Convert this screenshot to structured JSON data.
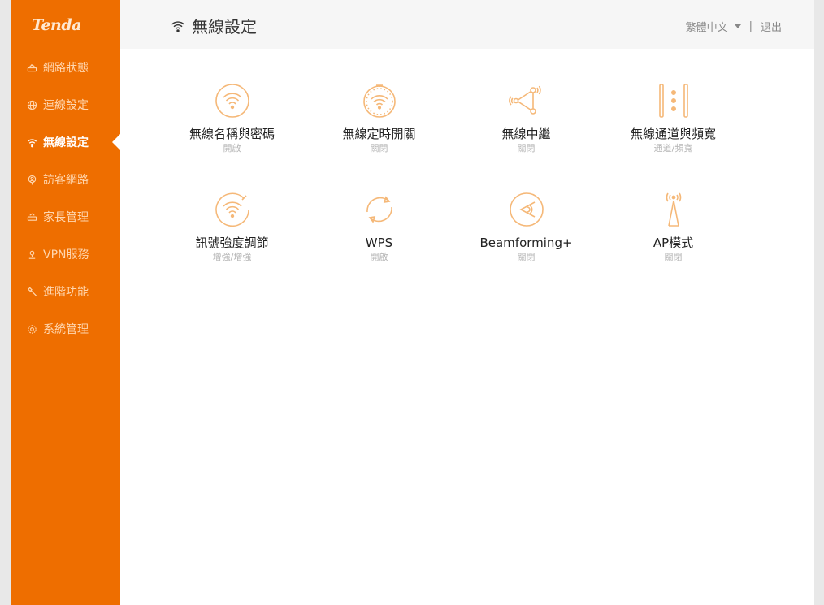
{
  "brand": {
    "logo_text": "Tenda",
    "accent_color": "#ee6e00",
    "icon_color": "#f5b878"
  },
  "sidebar": {
    "items": [
      {
        "label": "網路狀態",
        "icon": "router-icon",
        "active": false
      },
      {
        "label": "連線設定",
        "icon": "globe-icon",
        "active": false
      },
      {
        "label": "無線設定",
        "icon": "wifi-icon",
        "active": true
      },
      {
        "label": "訪客網路",
        "icon": "guest-icon",
        "active": false
      },
      {
        "label": "家長管理",
        "icon": "parental-icon",
        "active": false
      },
      {
        "label": "VPN服務",
        "icon": "vpn-icon",
        "active": false
      },
      {
        "label": "進階功能",
        "icon": "wrench-icon",
        "active": false
      },
      {
        "label": "系統管理",
        "icon": "gear-icon",
        "active": false
      }
    ]
  },
  "header": {
    "title": "無線設定",
    "language": "繁體中文",
    "separator": "|",
    "logout": "退出"
  },
  "tiles": [
    {
      "title": "無線名稱與密碼",
      "status": "開啟",
      "icon": "wifi-circle-icon"
    },
    {
      "title": "無線定時開關",
      "status": "關閉",
      "icon": "wifi-timer-icon"
    },
    {
      "title": "無線中繼",
      "status": "關閉",
      "icon": "repeater-icon"
    },
    {
      "title": "無線通道與頻寬",
      "status": "通道/頻寬",
      "icon": "channel-bandwidth-icon"
    },
    {
      "title": "訊號強度調節",
      "status": "增強/增強",
      "icon": "signal-strength-icon"
    },
    {
      "title": "WPS",
      "status": "開啟",
      "icon": "wps-icon"
    },
    {
      "title": "Beamforming+",
      "status": "關閉",
      "icon": "beamforming-icon"
    },
    {
      "title": "AP模式",
      "status": "關閉",
      "icon": "ap-mode-icon"
    }
  ]
}
